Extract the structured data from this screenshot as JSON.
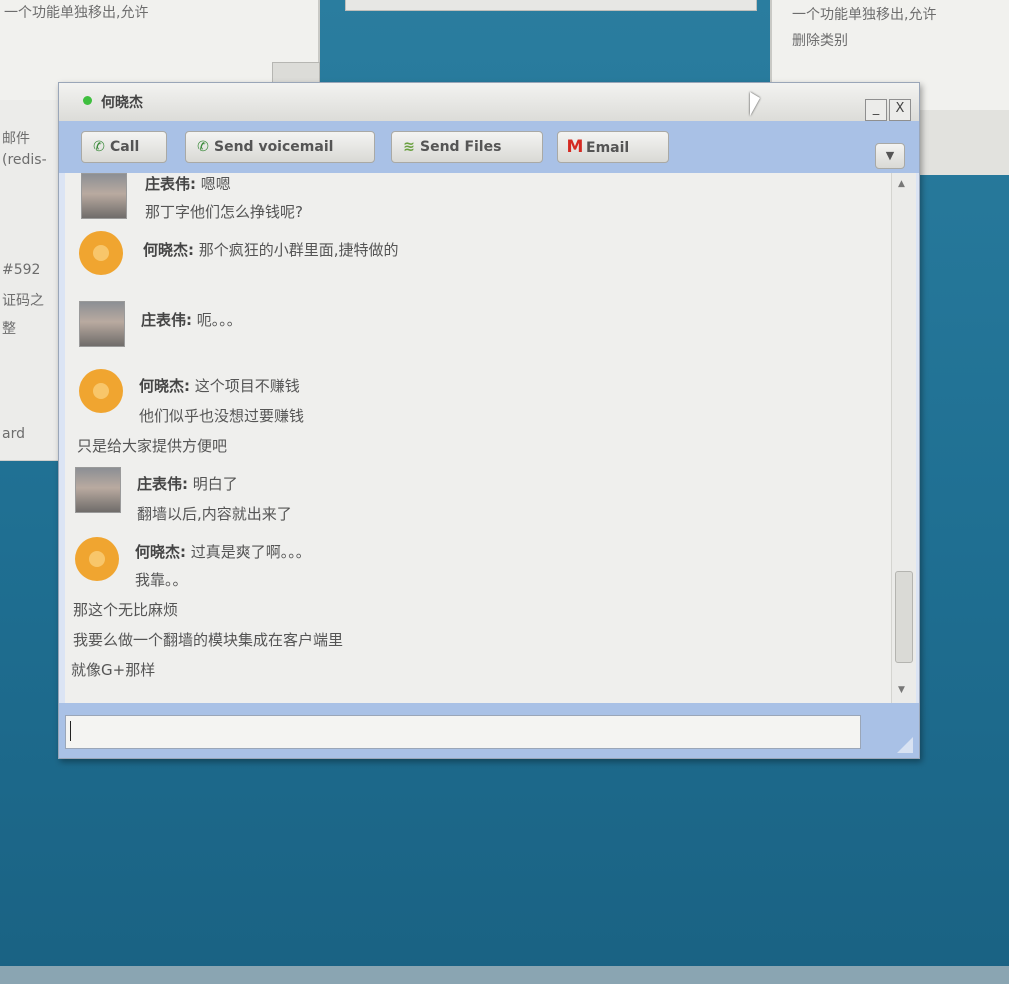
{
  "background": {
    "desktop_color": "#1f6f92",
    "left_window_text": [
      "邮件",
      "(redis-",
      "#592",
      "证码之",
      "整",
      "ard"
    ],
    "right_window_text": [
      "一个功能单独移出,允许",
      "删除类别"
    ]
  },
  "chat_window": {
    "title": "何晓杰",
    "presence": "online",
    "presence_color": "#3fbf3f",
    "toolbar": {
      "call_label": "Call",
      "voicemail_label": "Send voicemail",
      "files_label": "Send Files",
      "email_label": "Email"
    },
    "window_buttons": {
      "minimize": "_",
      "close": "X"
    },
    "messages": [
      {
        "avatar": "photo",
        "lines": [
          {
            "sender": "庄表伟:",
            "text": " 嗯嗯"
          },
          {
            "text": "那丁字他们怎么挣钱呢?"
          }
        ]
      },
      {
        "avatar": "sun",
        "lines": [
          {
            "sender": "何晓杰:",
            "text": " 那个疯狂的小群里面,捷特做的"
          }
        ]
      },
      {
        "avatar": "photo",
        "lines": [
          {
            "sender": "庄表伟:",
            "text": " 呃。。。"
          }
        ]
      },
      {
        "avatar": "sun",
        "lines": [
          {
            "sender": "何晓杰:",
            "text": " 这个项目不赚钱"
          },
          {
            "text": "他们似乎也没想过要赚钱"
          },
          {
            "text": "只是给大家提供方便吧"
          }
        ]
      },
      {
        "avatar": "photo",
        "lines": [
          {
            "sender": "庄表伟:",
            "text": " 明白了"
          },
          {
            "text": "翻墙以后,内容就出来了"
          }
        ]
      },
      {
        "avatar": "sun",
        "lines": [
          {
            "sender": "何晓杰:",
            "text": " 过真是爽了啊。。。"
          },
          {
            "text": "我靠。。"
          },
          {
            "text": "那这个无比麻烦"
          },
          {
            "text": "我要么做一个翻墙的模块集成在客户端里"
          },
          {
            "text": "就像G+那样"
          }
        ]
      }
    ],
    "input": {
      "value": ""
    }
  }
}
